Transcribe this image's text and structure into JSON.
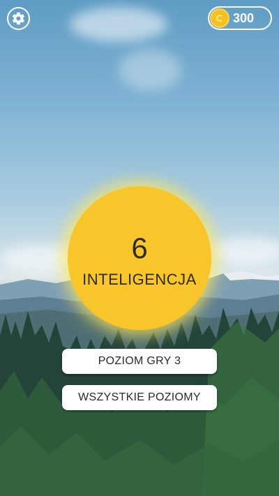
{
  "header": {
    "settings_icon": "gear-icon",
    "coins": {
      "icon": "coin-icon",
      "icon_color": "#f6c11c",
      "value": "300"
    }
  },
  "main": {
    "level_number": "6",
    "level_name": "INTELIGENCJA",
    "accent_color": "#f8c52a"
  },
  "buttons": {
    "level_label": "POZIOM GRY 3",
    "all_levels_label": "WSZYSTKIE POZIOMY"
  }
}
